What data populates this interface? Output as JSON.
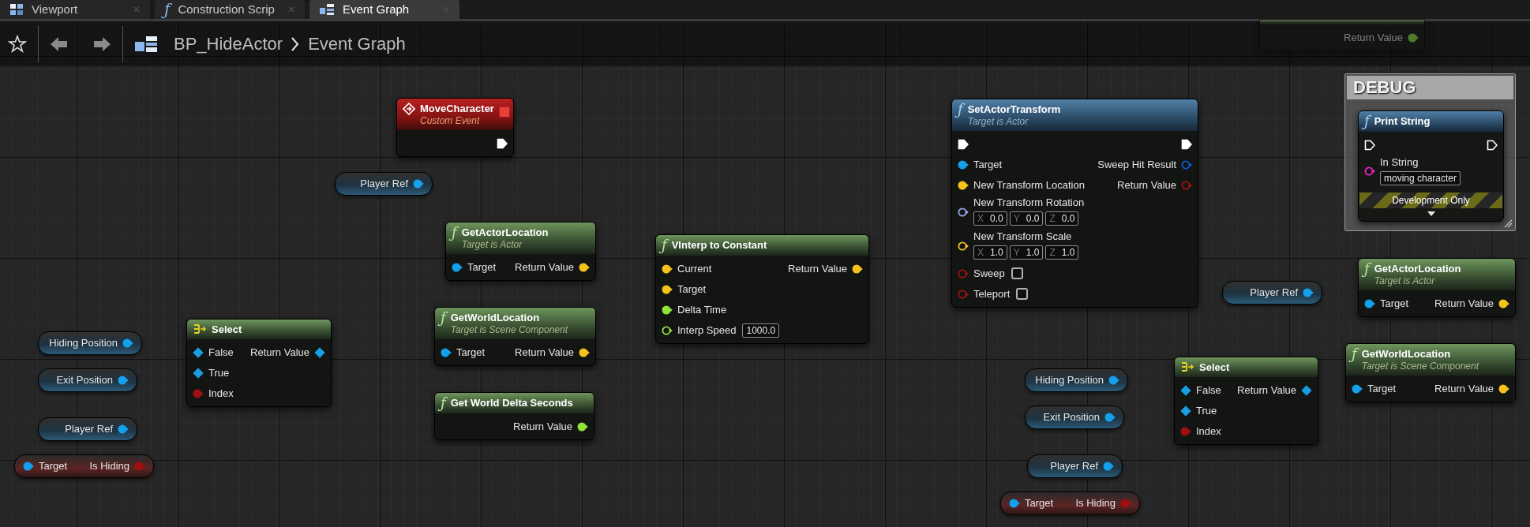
{
  "tabs": [
    {
      "kind": "viewport",
      "label": "Viewport",
      "selected": false
    },
    {
      "kind": "function",
      "glyph": "ƒ",
      "label": "Construction Scrip",
      "selected": false
    },
    {
      "kind": "graph",
      "label": "Event Graph",
      "selected": true
    }
  ],
  "breadcrumb": {
    "blueprint": "BP_HideActor",
    "graph": "Event Graph"
  },
  "nodes": [
    {
      "kind": "function",
      "pure": true,
      "rows": [
        {
          "right": {
            "kind": "float",
            "label": "Return Value",
            "connected": true
          }
        }
      ]
    },
    {
      "kind": "event",
      "title": "MoveCharacter",
      "subtitle": "Custom Event",
      "header_pin": {
        "kind": "delegate",
        "connected": true
      },
      "rows": [
        {
          "right": {
            "kind": "exec",
            "connected": true
          }
        }
      ]
    },
    {
      "kind": "function",
      "pure": false,
      "icon": "ƒ",
      "title": "SetActorTransform",
      "subtitle": "Target is Actor",
      "rows": [
        {
          "left": {
            "kind": "exec",
            "connected": true
          },
          "right": {
            "kind": "exec",
            "connected": true
          }
        },
        {
          "left": {
            "kind": "object",
            "label": "Target",
            "connected": true
          },
          "right": {
            "kind": "hit_result",
            "label": "Sweep Hit Result",
            "connected": false
          }
        },
        {
          "left": {
            "kind": "vector",
            "label": "New Transform Location",
            "connected": true
          },
          "right": {
            "kind": "bool",
            "label": "Return Value",
            "connected": false
          }
        },
        {
          "left": {
            "kind": "rotator",
            "label": "New Transform Rotation",
            "connected": false,
            "vector": [
              {
                "axis": "X",
                "value": "0.0"
              },
              {
                "axis": "Y",
                "value": "0.0"
              },
              {
                "axis": "Z",
                "value": "0.0"
              }
            ]
          }
        },
        {
          "left": {
            "kind": "vector",
            "label": "New Transform Scale",
            "connected": false,
            "vector": [
              {
                "axis": "X",
                "value": "1.0"
              },
              {
                "axis": "Y",
                "value": "1.0"
              },
              {
                "axis": "Z",
                "value": "1.0"
              }
            ]
          }
        },
        {
          "left": {
            "kind": "bool",
            "label": "Sweep",
            "connected": false,
            "checked": false
          }
        },
        {
          "left": {
            "kind": "bool",
            "label": "Teleport",
            "connected": false,
            "checked": false
          }
        }
      ]
    },
    {
      "kind": "comment",
      "title": "DEBUG"
    },
    {
      "kind": "function",
      "pure": false,
      "icon": "ƒ",
      "title": "Print String",
      "footer": "Development Only",
      "expandable": true,
      "rows": [
        {
          "left": {
            "kind": "exec",
            "connected": false
          },
          "right": {
            "kind": "exec",
            "connected": false
          }
        },
        {
          "left": {
            "kind": "string",
            "label": "In String",
            "connected": false,
            "value": "moving character"
          }
        }
      ]
    },
    {
      "kind": "variable",
      "rows": [
        {
          "right": {
            "kind": "object",
            "label": "Player Ref",
            "connected": true
          }
        }
      ]
    },
    {
      "kind": "function",
      "pure": true,
      "icon": "ƒ",
      "title": "GetActorLocation",
      "subtitle": "Target is Actor",
      "rows": [
        {
          "left": {
            "kind": "object",
            "label": "Target",
            "connected": true
          },
          "right": {
            "kind": "vector",
            "label": "Return Value",
            "connected": true
          }
        }
      ]
    },
    {
      "kind": "function",
      "pure": true,
      "icon": "ƒ",
      "title": "VInterp to Constant",
      "rows": [
        {
          "left": {
            "kind": "vector",
            "label": "Current",
            "connected": true
          },
          "right": {
            "kind": "vector",
            "label": "Return Value",
            "connected": true
          }
        },
        {
          "left": {
            "kind": "vector",
            "label": "Target",
            "connected": true
          }
        },
        {
          "left": {
            "kind": "float",
            "label": "Delta Time",
            "connected": true
          }
        },
        {
          "left": {
            "kind": "float",
            "label": "Interp Speed",
            "connected": false,
            "value": "1000.0"
          }
        }
      ]
    },
    {
      "kind": "function",
      "pure": true,
      "icon": "ƒ",
      "title": "GetActorLocation",
      "subtitle": "Target is Actor",
      "rows": [
        {
          "left": {
            "kind": "object",
            "label": "Target",
            "connected": true
          },
          "right": {
            "kind": "vector",
            "label": "Return Value",
            "connected": true
          }
        }
      ]
    },
    {
      "kind": "function",
      "pure": true,
      "icon": "ƒ",
      "title": "GetWorldLocation",
      "subtitle": "Target is Scene Component",
      "rows": [
        {
          "left": {
            "kind": "object",
            "label": "Target",
            "connected": true
          },
          "right": {
            "kind": "vector",
            "label": "Return Value",
            "connected": true
          }
        }
      ]
    },
    {
      "kind": "variable",
      "rows": [
        {
          "right": {
            "kind": "object",
            "label": "Player Ref",
            "connected": true
          }
        }
      ]
    },
    {
      "kind": "select",
      "title": "Select",
      "rows": [
        {
          "left": {
            "kind": "wildcard",
            "label": "False",
            "connected": true
          },
          "right": {
            "kind": "wildcard",
            "label": "Return Value",
            "connected": true
          }
        },
        {
          "left": {
            "kind": "wildcard",
            "label": "True",
            "connected": true
          }
        },
        {
          "left": {
            "kind": "bool",
            "label": "Index",
            "connected": true
          }
        }
      ]
    },
    {
      "kind": "variable",
      "rows": [
        {
          "right": {
            "kind": "object",
            "label": "Hiding Position",
            "connected": true
          }
        }
      ]
    },
    {
      "kind": "function",
      "pure": true,
      "icon": "ƒ",
      "title": "Get World Delta Seconds",
      "rows": [
        {
          "right": {
            "kind": "float",
            "label": "Return Value",
            "connected": true
          }
        }
      ]
    },
    {
      "kind": "function",
      "pure": true,
      "icon": "ƒ",
      "title": "GetWorldLocation",
      "subtitle": "Target is Scene Component",
      "rows": [
        {
          "left": {
            "kind": "object",
            "label": "Target",
            "connected": true
          },
          "right": {
            "kind": "vector",
            "label": "Return Value",
            "connected": true
          }
        }
      ]
    },
    {
      "kind": "variable",
      "rows": [
        {
          "right": {
            "kind": "object",
            "label": "Exit Position",
            "connected": true
          }
        }
      ]
    },
    {
      "kind": "select",
      "title": "Select",
      "rows": [
        {
          "left": {
            "kind": "wildcard",
            "label": "False",
            "connected": true
          },
          "right": {
            "kind": "wildcard",
            "label": "Return Value",
            "connected": true
          }
        },
        {
          "left": {
            "kind": "wildcard",
            "label": "True",
            "connected": true
          }
        },
        {
          "left": {
            "kind": "bool",
            "label": "Index",
            "connected": true
          }
        }
      ]
    },
    {
      "kind": "variable",
      "rows": [
        {
          "right": {
            "kind": "object",
            "label": "Hiding Position",
            "connected": true
          }
        }
      ]
    },
    {
      "kind": "variable",
      "rows": [
        {
          "right": {
            "kind": "object",
            "label": "Exit Position",
            "connected": true
          }
        }
      ]
    },
    {
      "kind": "variable",
      "rows": [
        {
          "right": {
            "kind": "object",
            "label": "Player Ref",
            "connected": true
          }
        }
      ]
    },
    {
      "kind": "property",
      "rows": [
        {
          "left": {
            "kind": "object",
            "label": "Target",
            "connected": true
          },
          "right": {
            "kind": "bool",
            "label": "Is Hiding",
            "connected": true
          }
        }
      ]
    },
    {
      "kind": "variable",
      "rows": [
        {
          "right": {
            "kind": "object",
            "label": "Player Ref",
            "connected": true
          }
        }
      ]
    },
    {
      "kind": "property",
      "rows": [
        {
          "left": {
            "kind": "object",
            "label": "Target",
            "connected": true
          },
          "right": {
            "kind": "bool",
            "label": "Is Hiding",
            "connected": true
          }
        }
      ]
    }
  ]
}
